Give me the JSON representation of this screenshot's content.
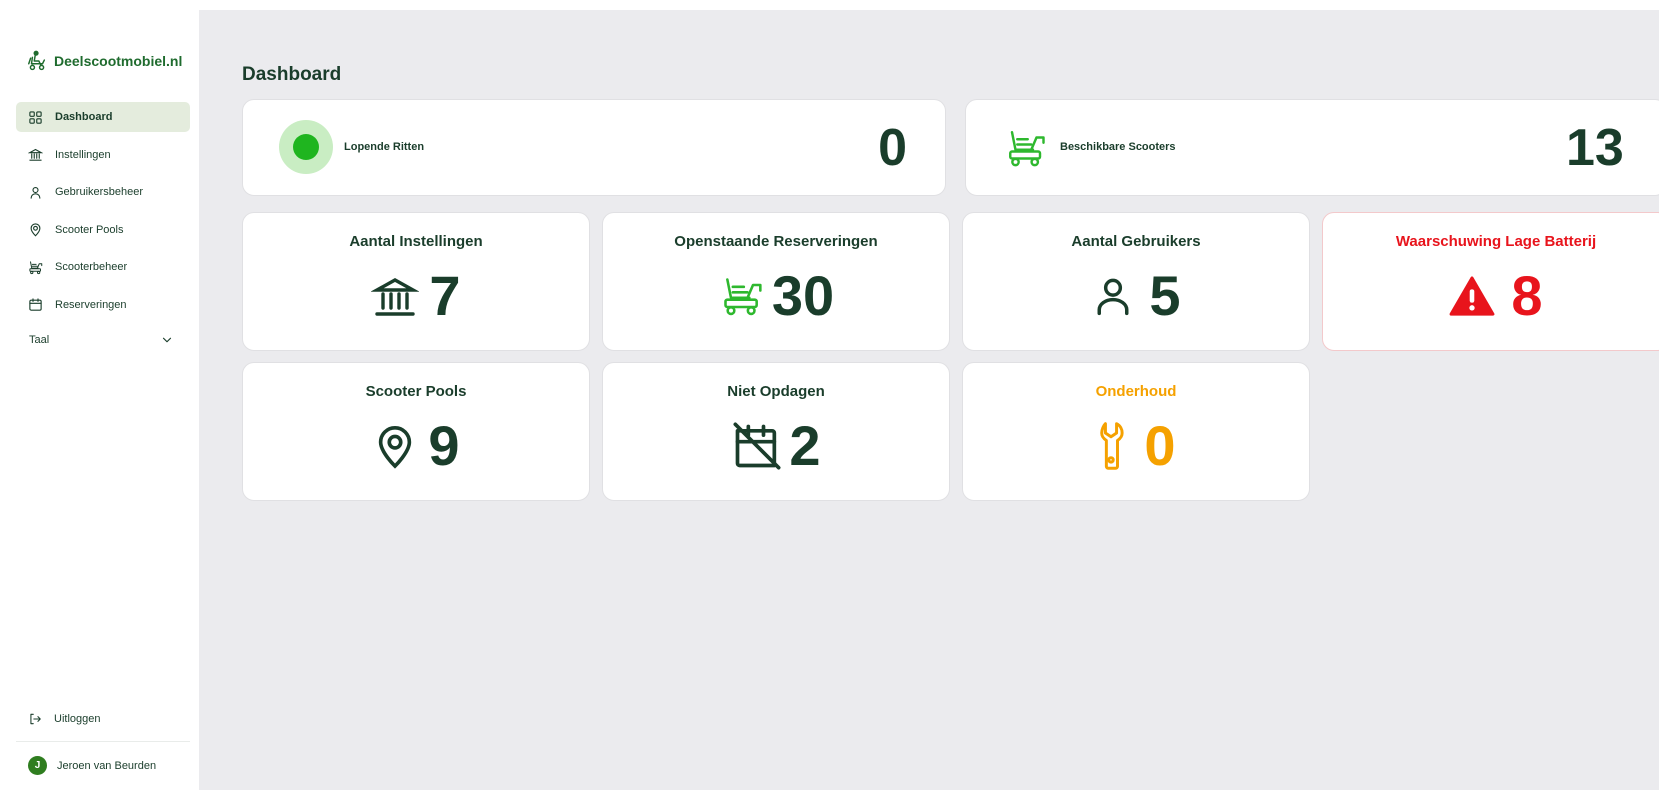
{
  "brand": {
    "name": "Deelscootmobiel.nl"
  },
  "nav": [
    {
      "label": "Dashboard",
      "icon": "dashboard-icon",
      "active": true
    },
    {
      "label": "Instellingen",
      "icon": "institution-icon"
    },
    {
      "label": "Gebruikersbeheer",
      "icon": "user-icon"
    },
    {
      "label": "Scooter Pools",
      "icon": "location-pin-icon"
    },
    {
      "label": "Scooterbeheer",
      "icon": "scooter-icon"
    },
    {
      "label": "Reserveringen",
      "icon": "calendar-icon"
    }
  ],
  "language": {
    "label": "Taal"
  },
  "logout": {
    "label": "Uitloggen"
  },
  "user": {
    "name": "Jeroen van Beurden",
    "initial": "J"
  },
  "page": {
    "title": "Dashboard"
  },
  "summary": [
    {
      "label": "Lopende Ritten",
      "value": "0",
      "icon": "status-dot-icon"
    },
    {
      "label": "Beschikbare Scooters",
      "value": "13",
      "icon": "scooter-icon"
    }
  ],
  "tiles": [
    {
      "title": "Aantal Instellingen",
      "value": "7",
      "icon": "institution-icon",
      "color": "#1a3d2b"
    },
    {
      "title": "Openstaande Reserveringen",
      "value": "30",
      "icon": "scooter-icon",
      "color": "#1a3d2b"
    },
    {
      "title": "Aantal Gebruikers",
      "value": "5",
      "icon": "user-icon",
      "color": "#1a3d2b"
    },
    {
      "title": "Waarschuwing Lage Batterij",
      "value": "8",
      "icon": "warning-icon",
      "color": "#e8141c"
    },
    {
      "title": "Scooter Pools",
      "value": "9",
      "icon": "location-pin-icon",
      "color": "#1a3d2b"
    },
    {
      "title": "Niet Opdagen",
      "value": "2",
      "icon": "calendar-off-icon",
      "color": "#1a3d2b"
    },
    {
      "title": "Onderhoud",
      "value": "0",
      "icon": "wrench-icon",
      "color": "#f5a100"
    }
  ],
  "colors": {
    "primary": "#1a3d2b",
    "brand_green": "#1f6b2e",
    "accent_green": "#2eb82e",
    "danger": "#e8141c",
    "warning": "#f5a100",
    "background": "#ebebee"
  }
}
